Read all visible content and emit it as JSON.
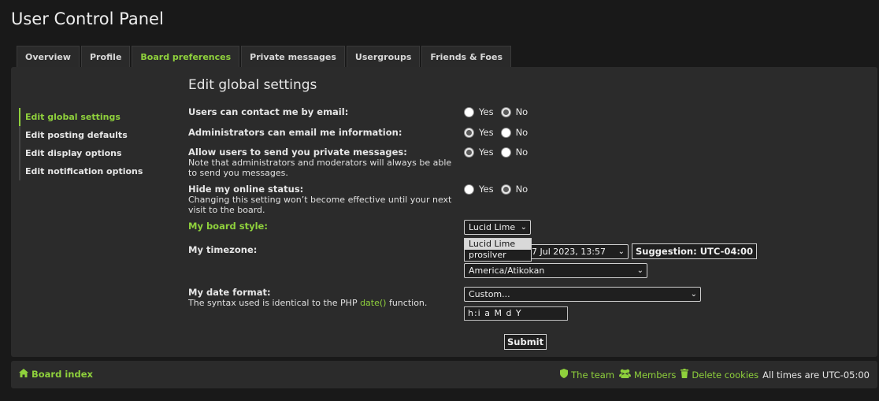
{
  "page": {
    "title": "User Control Panel"
  },
  "tabs": [
    {
      "label": "Overview"
    },
    {
      "label": "Profile"
    },
    {
      "label": "Board preferences"
    },
    {
      "label": "Private messages"
    },
    {
      "label": "Usergroups"
    },
    {
      "label": "Friends & Foes"
    }
  ],
  "active_tab": "Board preferences",
  "sidebar": {
    "items": [
      {
        "label": "Edit global settings"
      },
      {
        "label": "Edit posting defaults"
      },
      {
        "label": "Edit display options"
      },
      {
        "label": "Edit notification options"
      }
    ]
  },
  "main": {
    "section_title": "Edit global settings",
    "fields": {
      "contact_email": {
        "label": "Users can contact me by email:",
        "yes": "Yes",
        "no": "No",
        "value": "No"
      },
      "admin_email": {
        "label": "Administrators can email me information:",
        "yes": "Yes",
        "no": "No",
        "value": "Yes"
      },
      "allow_pm": {
        "label": "Allow users to send you private messages:",
        "note": "Note that administrators and moderators will always be able to send you messages.",
        "yes": "Yes",
        "no": "No",
        "value": "Yes"
      },
      "hide_online": {
        "label": "Hide my online status:",
        "note": "Changing this setting won’t become effective until your next visit to the board.",
        "yes": "Yes",
        "no": "No",
        "value": "No"
      },
      "board_style": {
        "label": "My board style:",
        "selected": "Lucid Lime",
        "options": [
          "Lucid Lime",
          "prosilver"
        ]
      },
      "timezone": {
        "label": "My timezone:",
        "date_value": "7 Jul 2023, 13:57",
        "suggestion": "Suggestion: UTC-04:00",
        "zone_value": "America/Atikokan"
      },
      "date_format": {
        "label": "My date format:",
        "note_prefix": "The syntax used is identical to the PHP ",
        "note_link": "date()",
        "note_suffix": " function.",
        "selected": "Custom...",
        "custom_value": "h:i a M d Y"
      }
    },
    "submit_label": "Submit"
  },
  "footer": {
    "board_index": "Board index",
    "the_team": "The team",
    "members": "Members",
    "delete_cookies": "Delete cookies",
    "timezone_note": "All times are UTC-05:00"
  },
  "colors": {
    "accent": "#8fd13c",
    "background": "#191919",
    "panel": "#2b2b2b"
  },
  "icons": {
    "home": "home-icon",
    "shield": "shield-icon",
    "users": "users-icon",
    "trash": "trash-icon",
    "chevron": "chevron-down-icon"
  }
}
